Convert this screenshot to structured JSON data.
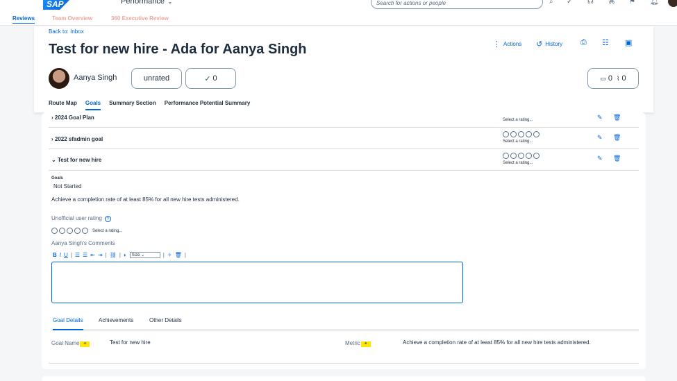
{
  "shell": {
    "logo_text": "SAP",
    "product": "Performance",
    "search_placeholder": "Search for actions or people"
  },
  "app_tabs": [
    "Reviews",
    "Team Overview",
    "360 Executive Review"
  ],
  "header": {
    "back_link": "Back to: Inbox",
    "title": "Test for new hire - Ada for Aanya Singh",
    "actions_label": "Actions",
    "history_label": "History",
    "person_name": "Aanya Singh",
    "rating_pill": "unrated",
    "check_count": "0",
    "comment_count": "0",
    "attach_count": "0",
    "sub_tabs": [
      "Route Map",
      "Goals",
      "Summary Section",
      "Performance Potential Summary"
    ]
  },
  "goals": {
    "rows": [
      {
        "title": "2024 Goal Plan",
        "rating_text": "Select a rating..."
      },
      {
        "title": "2022 sfadmin goal",
        "rating_text": "Select a rating..."
      },
      {
        "title": "Test for new hire",
        "rating_text": "Select a rating..."
      }
    ],
    "goals_label": "Goals",
    "status": "Not Started",
    "description": "Achieve a completion rate of at least 85% for all new hire tests administered.",
    "unofficial_label": "Unofficial user rating",
    "rating_text": "Select a rating...",
    "comments_label": "Aanya Singh's Comments",
    "size_label": "Size"
  },
  "detail_tabs": [
    "Goal Details",
    "Achievements",
    "Other Details"
  ],
  "details": {
    "goal_name_label": "Goal Name",
    "goal_name_value": "Test for new hire",
    "metric_label": "Metric",
    "metric_value": "Achieve a completion rate of at least 85% for all new hire tests administered."
  },
  "colors": {
    "accent": "#0064d9",
    "highlight": "#ffe600"
  }
}
